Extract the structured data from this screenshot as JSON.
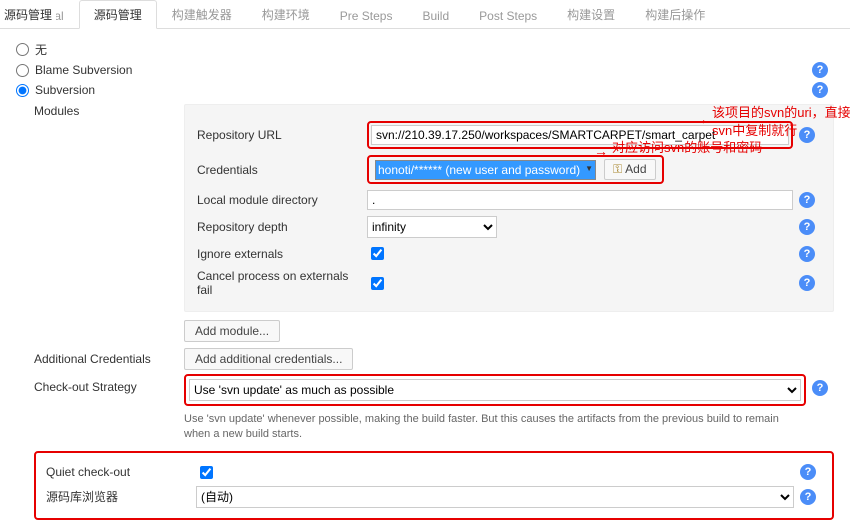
{
  "sidebar_label": "源码管理",
  "tabs": [
    "General",
    "源码管理",
    "构建触发器",
    "构建环境",
    "Pre Steps",
    "Build",
    "Post Steps",
    "构建设置",
    "构建后操作"
  ],
  "active_tab": 1,
  "scm": {
    "none_label": "无",
    "blame_label": "Blame Subversion",
    "svn_label": "Subversion"
  },
  "modules_label": "Modules",
  "fields": {
    "repo_url_label": "Repository URL",
    "repo_url_value": "svn://210.39.17.250/workspaces/SMARTCARPET/smart_carpet",
    "cred_label": "Credentials",
    "cred_value": "honoti/****** (new user and password)",
    "add_btn": "Add",
    "local_dir_label": "Local module directory",
    "local_dir_value": ".",
    "depth_label": "Repository depth",
    "depth_value": "infinity",
    "ignore_ext_label": "Ignore externals",
    "cancel_ext_label": "Cancel process on externals fail"
  },
  "add_module_btn": "Add module...",
  "additional_cred_label": "Additional Credentials",
  "additional_cred_btn": "Add additional credentials...",
  "checkout_label": "Check-out Strategy",
  "checkout_value": "Use 'svn update' as much as possible",
  "checkout_hint": "Use 'svn update' whenever possible, making the build faster. But this causes the artifacts from the previous build to remain when a new build starts.",
  "quiet_label": "Quiet check-out",
  "browser_label": "源码库浏览器",
  "browser_value": "(自动)",
  "annotations": {
    "url": "该项目的svn的uri，直接在svn中复制就行",
    "cred": "对应访问svn的账号和密码"
  }
}
